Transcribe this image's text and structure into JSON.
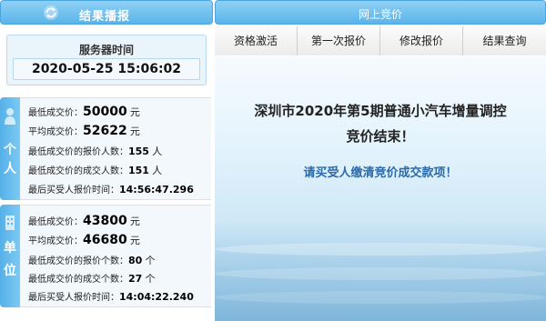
{
  "left_header": {
    "title": "结果播报",
    "icon": "refresh-icon"
  },
  "server_time": {
    "label": "服务器时间",
    "value": "2020-05-25 15:06:02"
  },
  "personal": {
    "tab_chars": [
      "个",
      "人"
    ],
    "tab_icon": "person-icon",
    "lowest_price_label": "最低成交价：",
    "lowest_price": "50000",
    "avg_price_label": "平均成交价：",
    "avg_price": "52622",
    "currency": "元",
    "lowest_bidders_label": "最低成交价的报价人数：",
    "lowest_bidders": "155",
    "lowest_winners_label": "最低成交价的成交人数：",
    "lowest_winners": "151",
    "count_unit": "人",
    "last_time_label": "最后买受人报价时间：",
    "last_time": "14:56:47.296"
  },
  "unit": {
    "tab_chars": [
      "单",
      "位"
    ],
    "tab_icon": "building-icon",
    "lowest_price_label": "最低成交价：",
    "lowest_price": "43800",
    "avg_price_label": "平均成交价：",
    "avg_price": "46680",
    "currency": "元",
    "lowest_bidders_label": "最低成交价的报价个数：",
    "lowest_bidders": "80",
    "lowest_winners_label": "最低成交价的成交个数：",
    "lowest_winners": "27",
    "count_unit": "个",
    "last_time_label": "最后买受人报价时间：",
    "last_time": "14:04:22.240"
  },
  "right_header": {
    "title": "网上竞价"
  },
  "tabs": [
    {
      "label": "资格激活"
    },
    {
      "label": "第一次报价"
    },
    {
      "label": "修改报价"
    },
    {
      "label": "结果查询"
    }
  ],
  "message": {
    "line1": "深圳市2020年第5期普通小汽车增量调控",
    "line2": "竞价结束！",
    "line3": "请买受人缴清竞价成交款项！"
  },
  "colors": {
    "header_blue": "#5ab4ea",
    "notice_blue": "#2b6aa8"
  }
}
